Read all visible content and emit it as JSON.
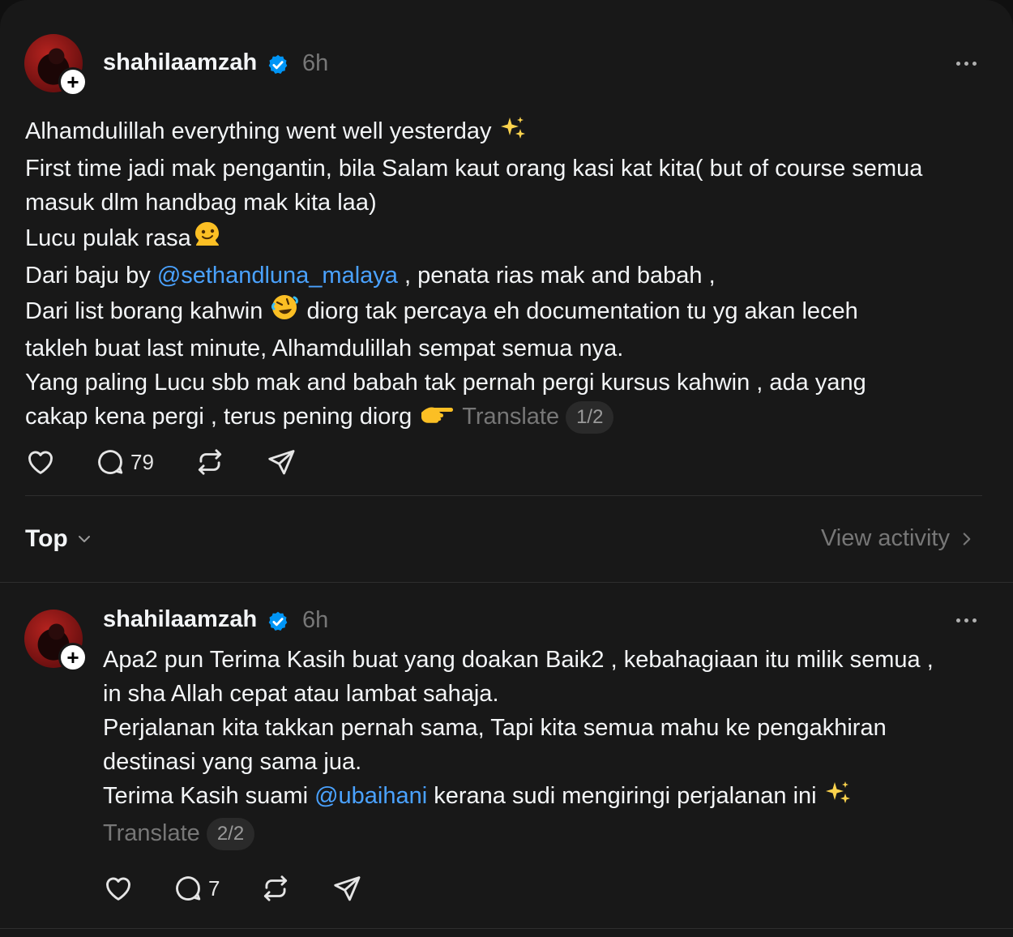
{
  "post": {
    "username": "shahilaamzah",
    "time": "6h",
    "lines": [
      {
        "text": "Alhamdulillah everything went well yesterday ",
        "emoji": "sparkles"
      },
      {
        "text": "First time jadi mak pengantin, bila Salam kaut orang kasi kat kita( but of course semua"
      },
      {
        "text": "masuk dlm handbag mak kita laa)"
      },
      {
        "text": "Lucu pulak rasa",
        "emoji": "melting"
      },
      {
        "pre": "Dari baju by ",
        "mention": "@sethandluna_malaya",
        "post": " , penata rias mak and babah ,"
      },
      {
        "pre": "Dari list borang kahwin ",
        "emoji": "rofl",
        "post": " diorg tak percaya eh documentation tu yg akan leceh"
      },
      {
        "text": "takleh buat last minute, Alhamdulillah sempat semua nya."
      },
      {
        "text": "Yang paling Lucu sbb mak and babah tak pernah pergi kursus kahwin , ada yang"
      },
      {
        "text": "cakap kena pergi , terus pening diorg ",
        "emoji": "pointing"
      }
    ],
    "translate": "Translate",
    "pager": "1/2",
    "comment_count": "79"
  },
  "filter": {
    "label": "Top",
    "view_activity": "View activity"
  },
  "reply": {
    "username": "shahilaamzah",
    "time": "6h",
    "lines": [
      {
        "text": "Apa2 pun Terima Kasih buat yang doakan Baik2 , kebahagiaan itu milik semua ,"
      },
      {
        "text": "in sha Allah cepat atau lambat sahaja."
      },
      {
        "text": "Perjalanan kita takkan pernah sama, Tapi kita semua mahu ke pengakhiran"
      },
      {
        "text": "destinasi yang sama jua."
      },
      {
        "pre": "Terima Kasih suami ",
        "mention": "@ubaihani",
        "post": " kerana sudi mengiringi perjalanan ini ",
        "emoji": "sparkles"
      }
    ],
    "translate": "Translate",
    "pager": "2/2",
    "comment_count": "7"
  },
  "colors": {
    "background": "#181818",
    "text": "#f3f5f7",
    "muted": "#777777",
    "mention": "#4aa2ff",
    "verified": "#0095f6"
  },
  "icons": [
    "plus-icon",
    "verified-badge-icon",
    "more-icon",
    "heart-icon",
    "comment-icon",
    "repost-icon",
    "share-icon",
    "chevron-down-icon",
    "chevron-right-icon"
  ]
}
